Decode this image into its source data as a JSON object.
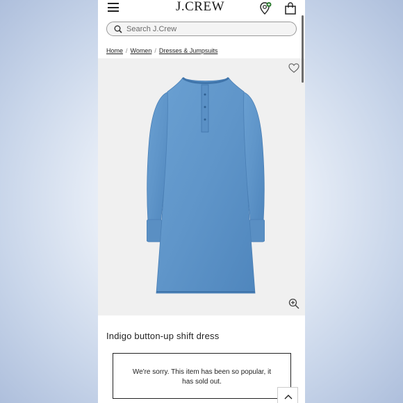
{
  "header": {
    "logo_text": "J.CREW",
    "icons": [
      "menu-icon",
      "store-locator-icon",
      "bag-icon"
    ]
  },
  "search": {
    "placeholder": "Search J.Crew"
  },
  "breadcrumb": {
    "items": [
      "Home",
      "Women",
      "Dresses & Jumpsuits"
    ],
    "separator": "/"
  },
  "product": {
    "title": "Indigo button-up shift dress",
    "sold_out_message": "We're sorry. This item has been so popular, it has sold out.",
    "image_colors": {
      "denim": "#5f95c9",
      "denim_dark": "#4a7fb5",
      "background": "#f0f0f0"
    }
  },
  "colors": {
    "badge_green": "#2e7d32"
  }
}
